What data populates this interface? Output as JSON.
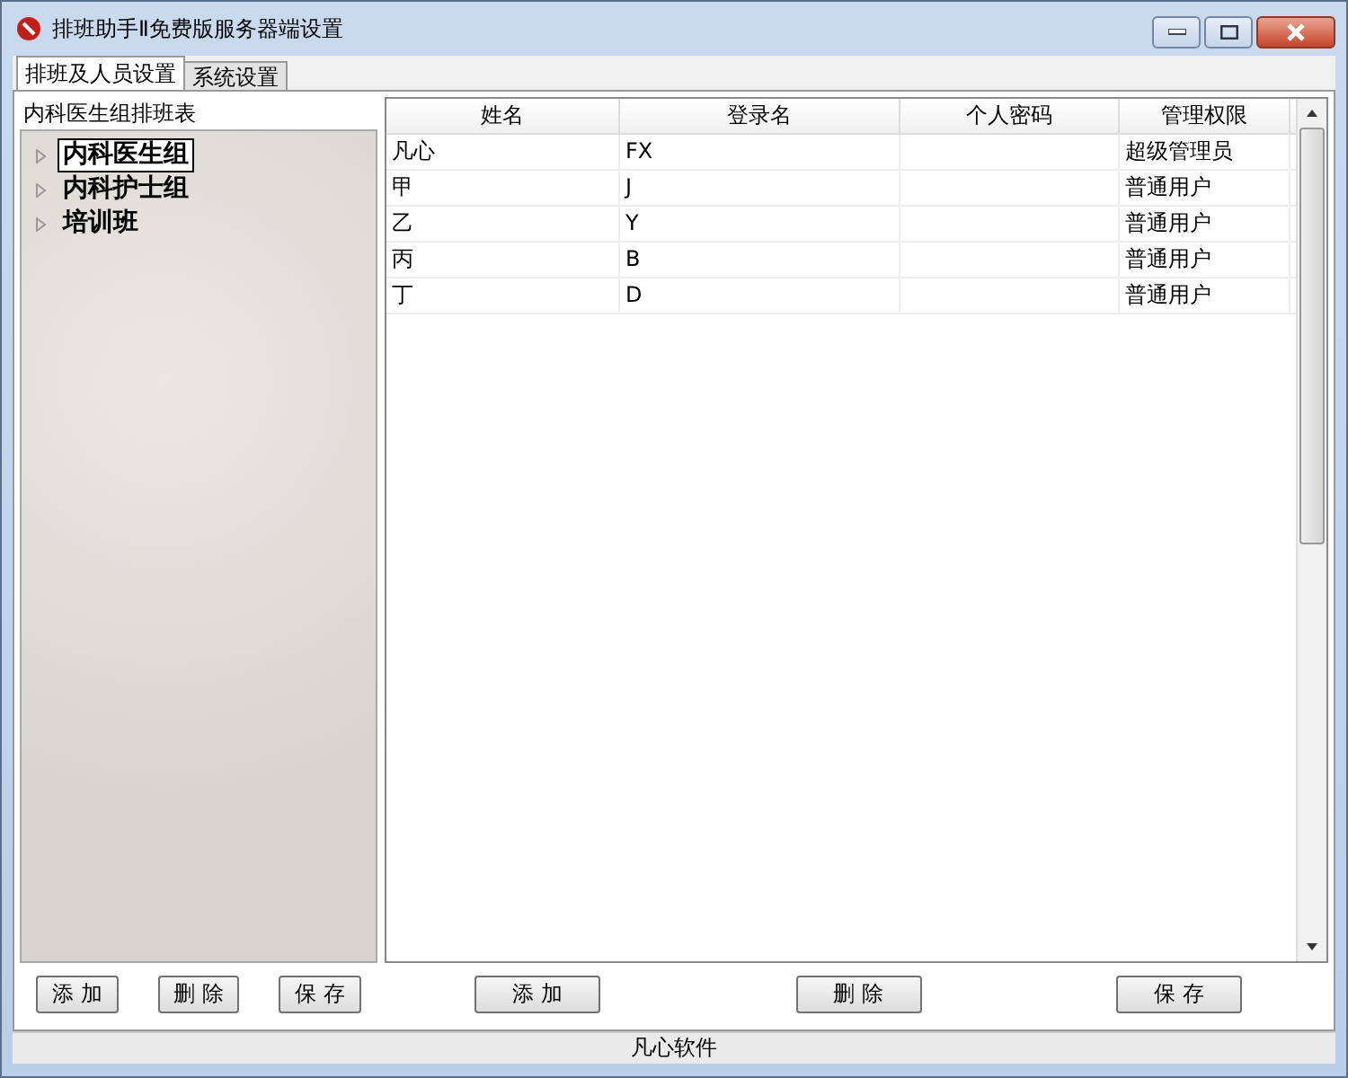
{
  "window": {
    "title": "排班助手Ⅱ免费版服务器端设置"
  },
  "tabs": [
    {
      "label": "排班及人员设置",
      "selected": true
    },
    {
      "label": "系统设置",
      "selected": false
    }
  ],
  "left_panel": {
    "title": "内科医生组排班表",
    "tree": [
      {
        "label": "内科医生组",
        "selected": true,
        "expanded": false
      },
      {
        "label": "内科护士组",
        "selected": false,
        "expanded": false
      },
      {
        "label": "培训班",
        "selected": false,
        "expanded": false
      }
    ],
    "buttons": [
      "添 加",
      "删 除",
      "保 存"
    ]
  },
  "table": {
    "columns": [
      "姓名",
      "登录名",
      "个人密码",
      "管理权限"
    ],
    "rows": [
      {
        "name": "凡心",
        "login": "FX",
        "role": "超级管理员"
      },
      {
        "name": "甲",
        "login": "J",
        "role": "普通用户"
      },
      {
        "name": "乙",
        "login": "Y",
        "role": "普通用户"
      },
      {
        "name": "丙",
        "login": "B",
        "role": "普通用户"
      },
      {
        "name": "丁",
        "login": "D",
        "role": "普通用户"
      }
    ],
    "buttons": [
      "添 加",
      "删 除",
      "保 存"
    ]
  },
  "status_bar": "凡心软件"
}
